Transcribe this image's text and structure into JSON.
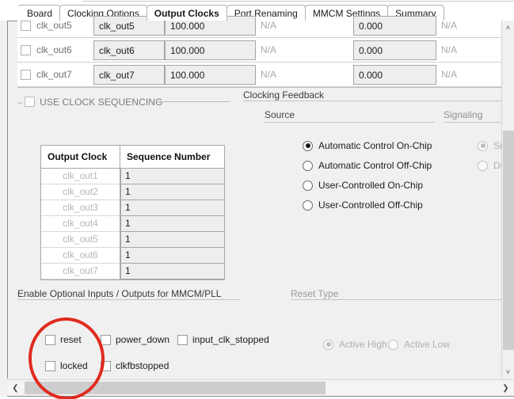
{
  "tabs": [
    {
      "label": "Board",
      "active": false
    },
    {
      "label": "Clocking Options",
      "active": false
    },
    {
      "label": "Output Clocks",
      "active": true
    },
    {
      "label": "Port Renaming",
      "active": false
    },
    {
      "label": "MMCM Settings",
      "active": false
    },
    {
      "label": "Summary",
      "active": false
    }
  ],
  "clock_table": {
    "rows": [
      {
        "name": "clk_out5",
        "port": "clk_out5",
        "freq": "100.000",
        "na1": "N/A",
        "phase": "0.000",
        "na2": "N/A"
      },
      {
        "name": "clk_out6",
        "port": "clk_out6",
        "freq": "100.000",
        "na1": "N/A",
        "phase": "0.000",
        "na2": "N/A"
      },
      {
        "name": "clk_out7",
        "port": "clk_out7",
        "freq": "100.000",
        "na1": "N/A",
        "phase": "0.000",
        "na2": "N/A"
      }
    ]
  },
  "sequencing": {
    "checkbox_label": "USE CLOCK SEQUENCING",
    "checked": false,
    "headers": [
      "Output Clock",
      "Sequence Number"
    ],
    "rows": [
      {
        "clock": "clk_out1",
        "sequence": "1"
      },
      {
        "clock": "clk_out2",
        "sequence": "1"
      },
      {
        "clock": "clk_out3",
        "sequence": "1"
      },
      {
        "clock": "clk_out4",
        "sequence": "1"
      },
      {
        "clock": "clk_out5",
        "sequence": "1"
      },
      {
        "clock": "clk_out6",
        "sequence": "1"
      },
      {
        "clock": "clk_out7",
        "sequence": "1"
      }
    ]
  },
  "clocking_feedback": {
    "title": "Clocking Feedback",
    "source_title": "Source",
    "signaling_title": "Signaling",
    "source_options": [
      {
        "label": "Automatic Control On-Chip",
        "selected": true
      },
      {
        "label": "Automatic Control Off-Chip",
        "selected": false
      },
      {
        "label": "User-Controlled On-Chip",
        "selected": false
      },
      {
        "label": "User-Controlled Off-Chip",
        "selected": false
      }
    ],
    "signaling_options": [
      {
        "label": "Sin",
        "selected": true
      },
      {
        "label": "Dif",
        "selected": false
      }
    ]
  },
  "optional_io": {
    "title": "Enable Optional Inputs / Outputs for MMCM/PLL",
    "checkboxes": [
      {
        "label": "reset",
        "checked": false
      },
      {
        "label": "power_down",
        "checked": false
      },
      {
        "label": "input_clk_stopped",
        "checked": false
      },
      {
        "label": "locked",
        "checked": false
      },
      {
        "label": "clkfbstopped",
        "checked": false
      }
    ]
  },
  "reset_type": {
    "title": "Reset Type",
    "options": [
      {
        "label": "Active High",
        "selected": true
      },
      {
        "label": "Active Low",
        "selected": false
      }
    ]
  },
  "scrollbars": {
    "v_up": "˄",
    "v_down": "˅",
    "h_left": "❮",
    "h_right": "❯"
  },
  "annotation": {
    "color": "#e02b20",
    "shape": "ellipse"
  }
}
